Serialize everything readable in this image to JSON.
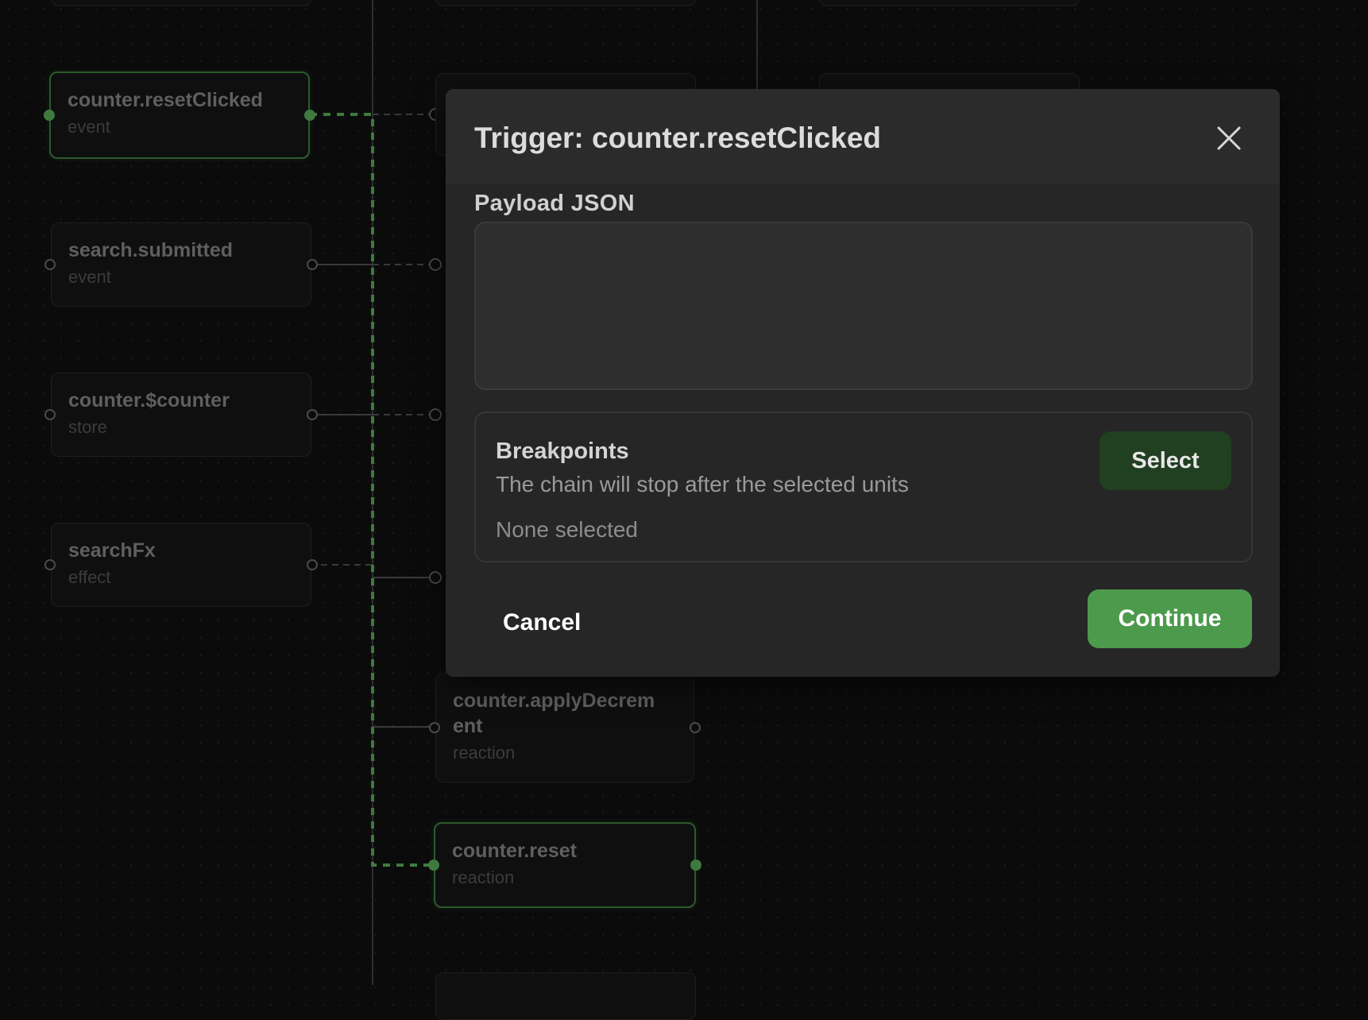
{
  "dialog": {
    "title": "Trigger: counter.resetClicked",
    "payload_label": "Payload JSON",
    "payload_value": "",
    "breakpoints": {
      "title": "Breakpoints",
      "description": "The chain will stop after the selected units",
      "selection_status": "None selected",
      "select_label": "Select"
    },
    "cancel_label": "Cancel",
    "continue_label": "Continue"
  },
  "graph": {
    "left_column": [
      {
        "title": "counter.resetClicked",
        "kind": "event",
        "active": true
      },
      {
        "title": "search.submitted",
        "kind": "event",
        "active": false
      },
      {
        "title": "counter.$counter",
        "kind": "store",
        "active": false
      },
      {
        "title": "searchFx",
        "kind": "effect",
        "active": false
      }
    ],
    "middle_column": [
      {
        "title": "counter.applyDecrem ent",
        "kind": "reaction",
        "active": false
      },
      {
        "title": "counter.reset",
        "kind": "reaction",
        "active": true
      }
    ]
  },
  "colors": {
    "active_accent": "#4c9a4c",
    "select_button": "#213f21",
    "dialog_bg": "#262626",
    "canvas_bg": "#0b0b0b"
  }
}
